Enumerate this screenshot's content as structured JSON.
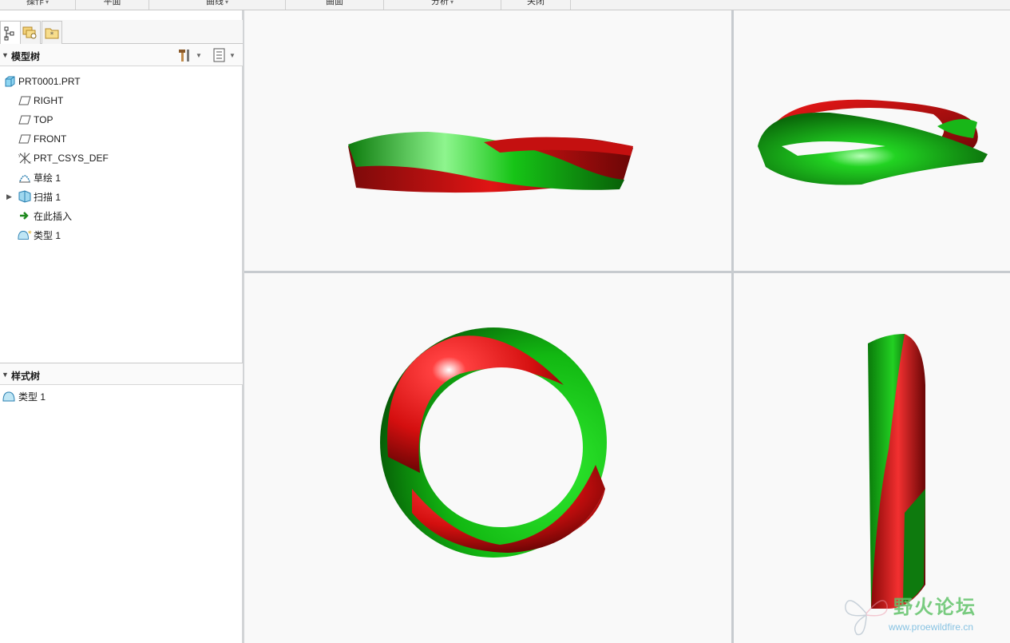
{
  "ribbon": {
    "tabs": [
      {
        "label": "操作",
        "has_dropdown": true
      },
      {
        "label": "平面",
        "has_dropdown": false
      },
      {
        "label": "曲线",
        "has_dropdown": true
      },
      {
        "label": "曲面",
        "has_dropdown": false
      },
      {
        "label": "分析",
        "has_dropdown": true
      },
      {
        "label": "关闭",
        "has_dropdown": false
      }
    ]
  },
  "panel_tabs": [
    {
      "icon": "model-tree-tab-icon",
      "active": true
    },
    {
      "icon": "folder-browser-tab-icon",
      "active": false
    },
    {
      "icon": "favorites-tab-icon",
      "active": false
    }
  ],
  "model_tree": {
    "title": "模型树",
    "tools": [
      "hammer-settings-icon",
      "tree-columns-icon"
    ],
    "items": [
      {
        "label": "PRT0001.PRT",
        "icon": "part-icon"
      },
      {
        "label": "RIGHT",
        "icon": "datum-plane-icon"
      },
      {
        "label": "TOP",
        "icon": "datum-plane-icon"
      },
      {
        "label": "FRONT",
        "icon": "datum-plane-icon"
      },
      {
        "label": "PRT_CSYS_DEF",
        "icon": "coordinate-system-icon"
      },
      {
        "label": "草绘 1",
        "icon": "sketch-icon"
      },
      {
        "label": "扫描 1",
        "icon": "sweep-icon",
        "expandable": true
      },
      {
        "label": "在此插入",
        "icon": "insert-here-arrow-icon"
      },
      {
        "label": "类型 1",
        "icon": "style-feature-icon"
      }
    ]
  },
  "style_tree": {
    "title": "样式树",
    "items": [
      {
        "label": "类型 1",
        "icon": "style-feature-icon"
      }
    ]
  },
  "colors": {
    "surface_green": "#16c416",
    "surface_red": "#d41414",
    "viewport_bg": "#f9f9f9",
    "divider": "#c7cbcf"
  },
  "watermark": {
    "title": "野火论坛",
    "url": "www.proewildfire.cn"
  }
}
